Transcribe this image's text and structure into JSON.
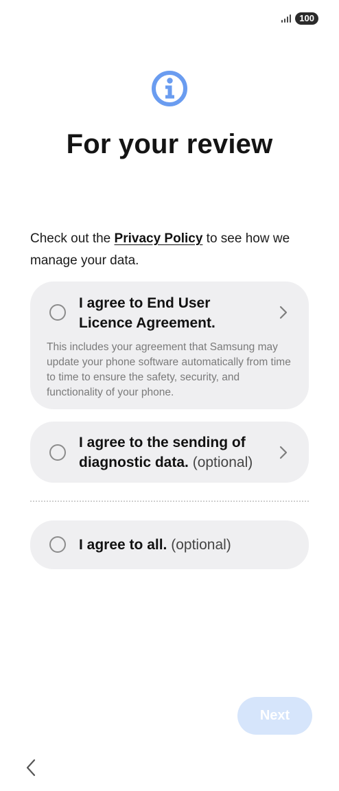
{
  "status_bar": {
    "battery": "100",
    "signal_icon": "signal-icon"
  },
  "header": {
    "icon": "info-icon",
    "title": "For your review"
  },
  "intro": {
    "prefix": "Check out the ",
    "link_label": "Privacy Policy",
    "suffix": " to see how we manage your data."
  },
  "agreements": {
    "eula": {
      "title": "I agree to End User Licence Agreement.",
      "description": "This includes your agreement that Samsung may update your phone software automatically from time to time to ensure the safety, security, and functionality of your phone.",
      "checked": false
    },
    "diagnostic": {
      "title": "I agree to the sending of diagnostic data.",
      "optional": "(optional)",
      "checked": false
    },
    "all": {
      "title": "I agree to all.",
      "optional": "(optional)",
      "checked": false
    }
  },
  "footer": {
    "next_label": "Next",
    "next_enabled": false,
    "back_icon": "back-chevron-icon"
  },
  "colors": {
    "accent_blue": "#6a9cf0",
    "card_bg": "#efeff1",
    "next_disabled_bg": "#d6e5fb"
  }
}
